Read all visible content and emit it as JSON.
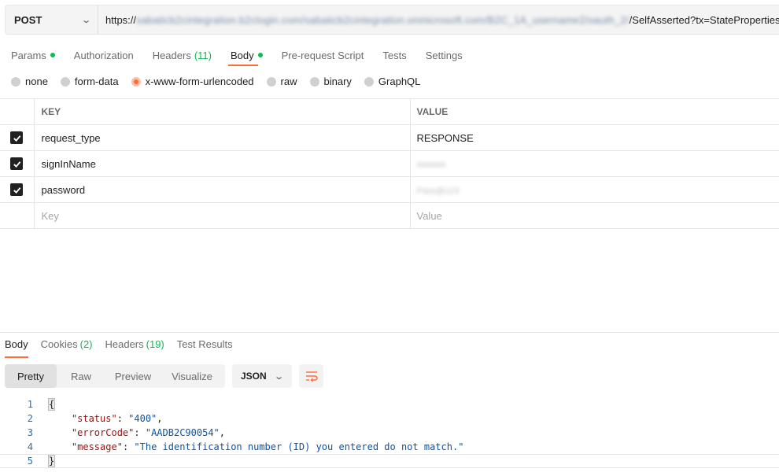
{
  "request": {
    "method": "POST",
    "url_prefix": "https://",
    "url_blurred": "sabaticb2cintegration.b2clogin.com/sabaticb2cintegration.onmicrosoft.com/B2C_1A_username2/oauth_2/",
    "url_suffix": "/SelfAsserted?tx=StateProperties=eyJUSUQiOiJ"
  },
  "request_tabs": [
    {
      "label": "Params",
      "dot": true
    },
    {
      "label": "Authorization"
    },
    {
      "label": "Headers",
      "count": "(11)"
    },
    {
      "label": "Body",
      "dot": true,
      "active": true
    },
    {
      "label": "Pre-request Script"
    },
    {
      "label": "Tests"
    },
    {
      "label": "Settings"
    }
  ],
  "body_types": [
    {
      "label": "none"
    },
    {
      "label": "form-data"
    },
    {
      "label": "x-www-form-urlencoded",
      "selected": true
    },
    {
      "label": "raw"
    },
    {
      "label": "binary"
    },
    {
      "label": "GraphQL"
    }
  ],
  "params_table": {
    "headers": {
      "key": "KEY",
      "value": "VALUE"
    },
    "rows": [
      {
        "key": "request_type",
        "value": "RESPONSE",
        "checked": true,
        "blurred": false
      },
      {
        "key": "signInName",
        "value": "444444",
        "checked": true,
        "blurred": true
      },
      {
        "key": "password",
        "value": "Pass@123",
        "checked": true,
        "blurred": true
      }
    ],
    "placeholder": {
      "key": "Key",
      "value": "Value"
    }
  },
  "response_tabs": [
    {
      "label": "Body",
      "active": true
    },
    {
      "label": "Cookies",
      "count": "(2)"
    },
    {
      "label": "Headers",
      "count": "(19)"
    },
    {
      "label": "Test Results"
    }
  ],
  "view_modes": [
    "Pretty",
    "Raw",
    "Preview",
    "Visualize"
  ],
  "active_view_mode": "Pretty",
  "format": "JSON",
  "icons": {
    "method_chevron": "chevron-down-icon",
    "format_chevron": "chevron-down-icon",
    "wrap": "wrap-lines-icon",
    "checkbox": "checkmark-icon"
  },
  "colors": {
    "accent": "#ff6c37",
    "green": "#0cbb52"
  },
  "response_body": [
    {
      "num": "1",
      "open": "{"
    },
    {
      "num": "2",
      "key": "\"status\"",
      "value": "\"400\"",
      "comma": ","
    },
    {
      "num": "3",
      "key": "\"errorCode\"",
      "value": "\"AADB2C90054\"",
      "comma": ","
    },
    {
      "num": "4",
      "key": "\"message\"",
      "value": "\"The identification number (ID) you entered do not match.\""
    },
    {
      "num": "5",
      "close": "}"
    }
  ]
}
